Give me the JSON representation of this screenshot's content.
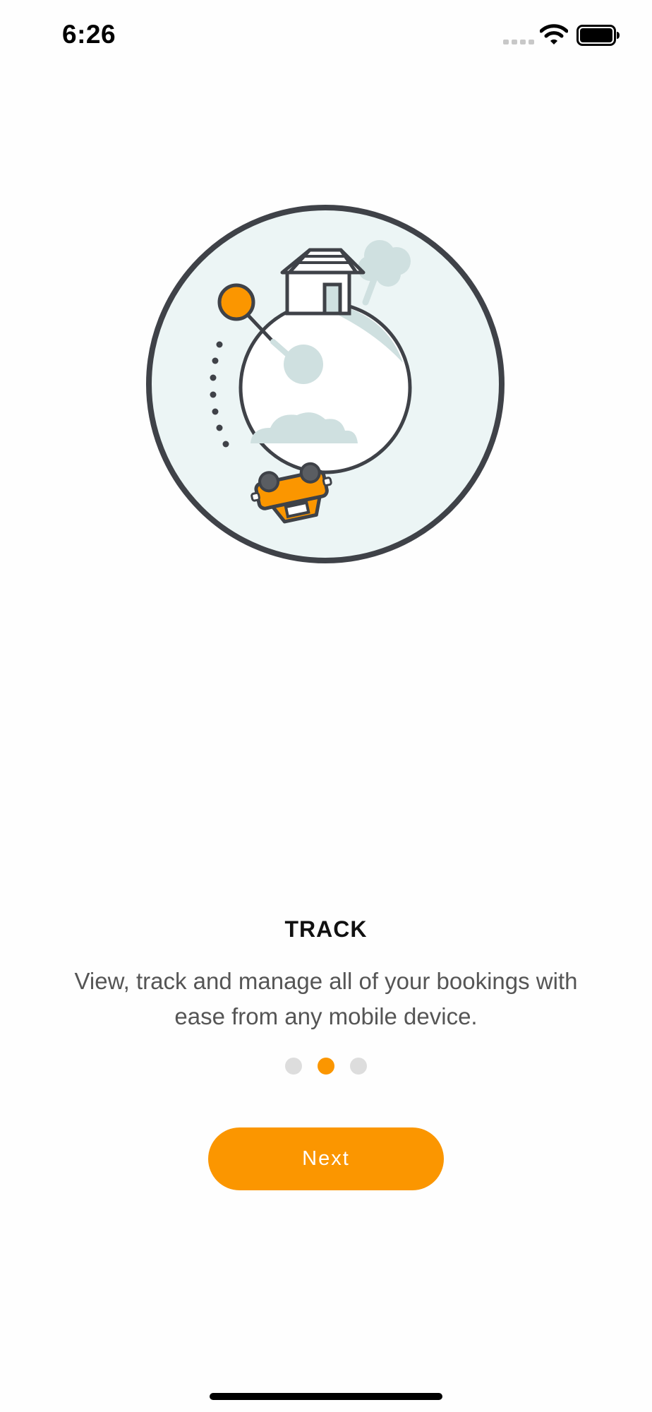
{
  "status_bar": {
    "time": "6:26",
    "icons": [
      "signal-icon",
      "wifi-icon",
      "battery-icon"
    ]
  },
  "onboarding": {
    "illustration": "globe-house-car-illustration",
    "title": "TRACK",
    "description": "View, track and manage all of your bookings with ease from any mobile device.",
    "pager": {
      "total": 3,
      "active_index": 1
    },
    "next_label": "Next"
  },
  "colors": {
    "accent": "#fb9600",
    "dot_inactive": "#dddddd",
    "illustration_outline": "#3f4248",
    "illustration_fill": "#ecf5f5",
    "illustration_shade": "#cfe0e0"
  }
}
